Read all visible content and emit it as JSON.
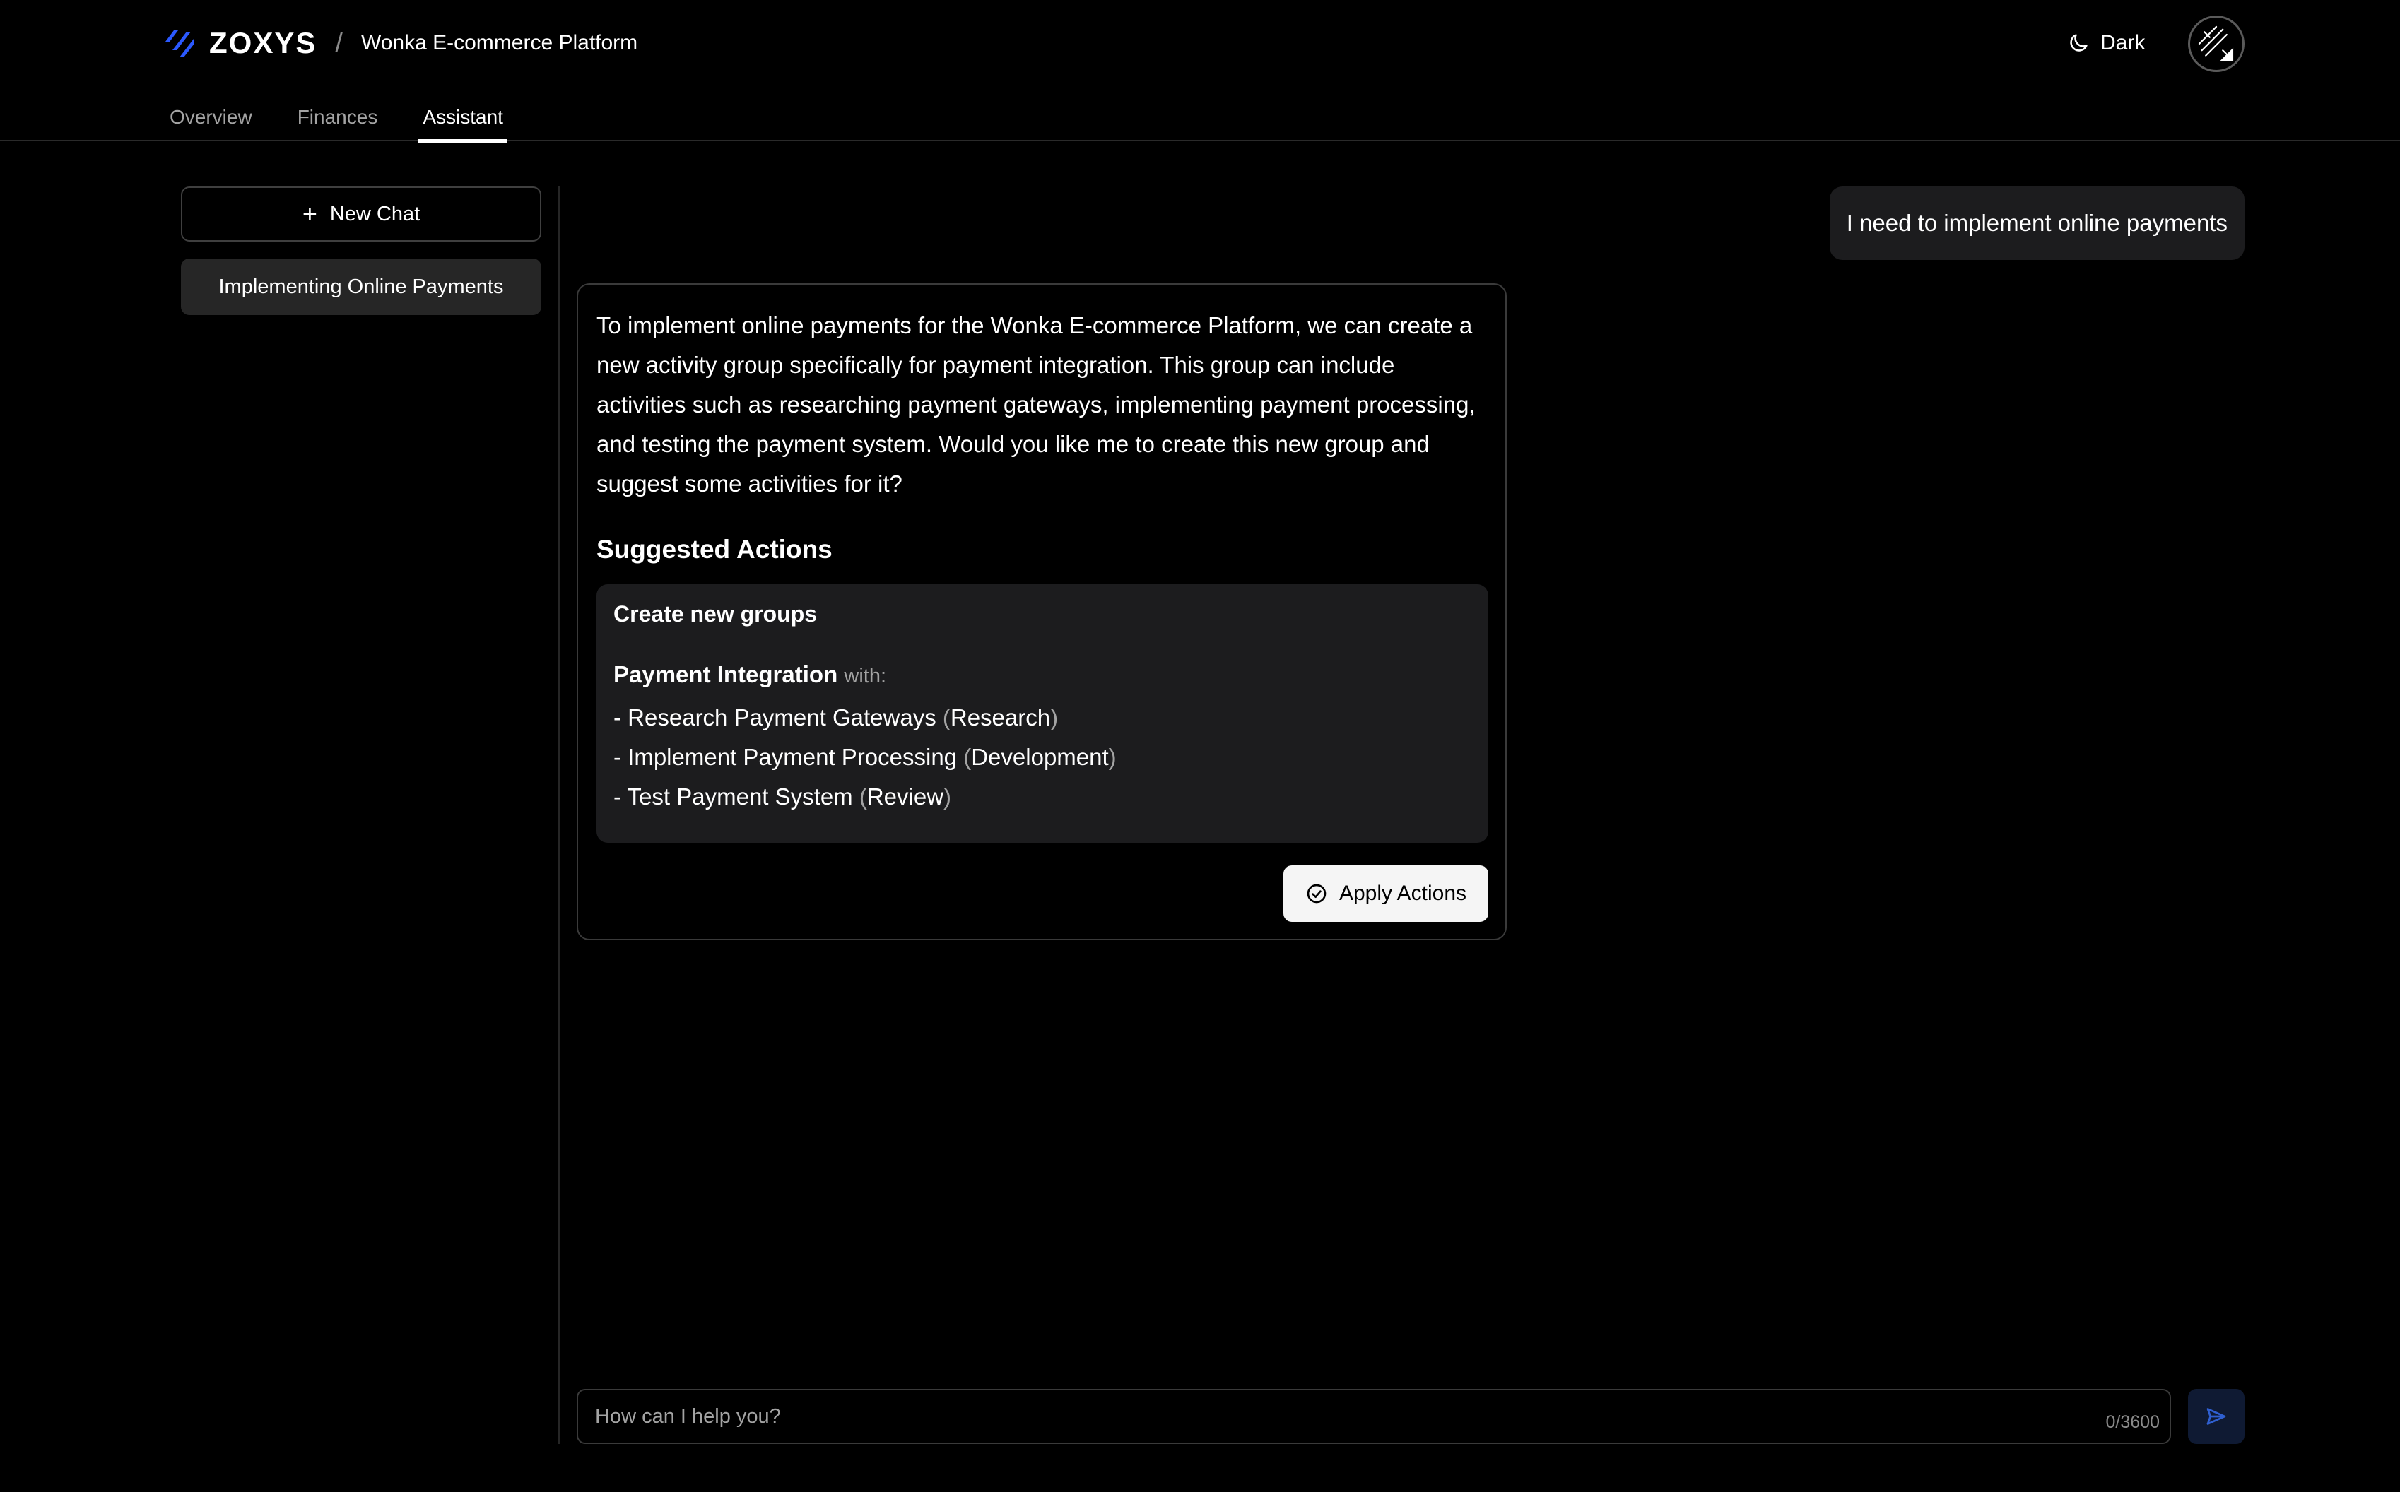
{
  "header": {
    "logo_text": "ZOXYS",
    "breadcrumb_separator": "/",
    "project_name": "Wonka E-commerce Platform",
    "theme_label": "Dark"
  },
  "tabs": [
    {
      "label": "Overview",
      "active": false
    },
    {
      "label": "Finances",
      "active": false
    },
    {
      "label": "Assistant",
      "active": true
    }
  ],
  "sidebar": {
    "new_chat_label": "New Chat",
    "chats": [
      {
        "title": "Implementing Online Payments"
      }
    ]
  },
  "chat": {
    "user_message": "I need to implement online payments",
    "assistant_message": "To implement online payments for the Wonka E-commerce Platform, we can create a new activity group specifically for payment integration. This group can include activities such as researching payment gateways, implementing payment processing, and testing the payment system. Would you like me to create this new group and suggest some activities for it?",
    "suggested_heading": "Suggested Actions",
    "action": {
      "title": "Create new groups",
      "group_name": "Payment Integration",
      "with_label": "with:",
      "activities": [
        {
          "name": "Research Payment Gateways",
          "type": "Research"
        },
        {
          "name": "Implement Payment Processing",
          "type": "Development"
        },
        {
          "name": "Test Payment System",
          "type": "Review"
        }
      ]
    },
    "apply_label": "Apply Actions"
  },
  "composer": {
    "placeholder": "How can I help you?",
    "char_count": "0/3600"
  },
  "colors": {
    "background": "#000000",
    "surface": "#1c1c1e",
    "logo_accent": "#2b59ff",
    "send_button_bg": "#0f1a33",
    "send_icon": "#2f5fd0"
  }
}
